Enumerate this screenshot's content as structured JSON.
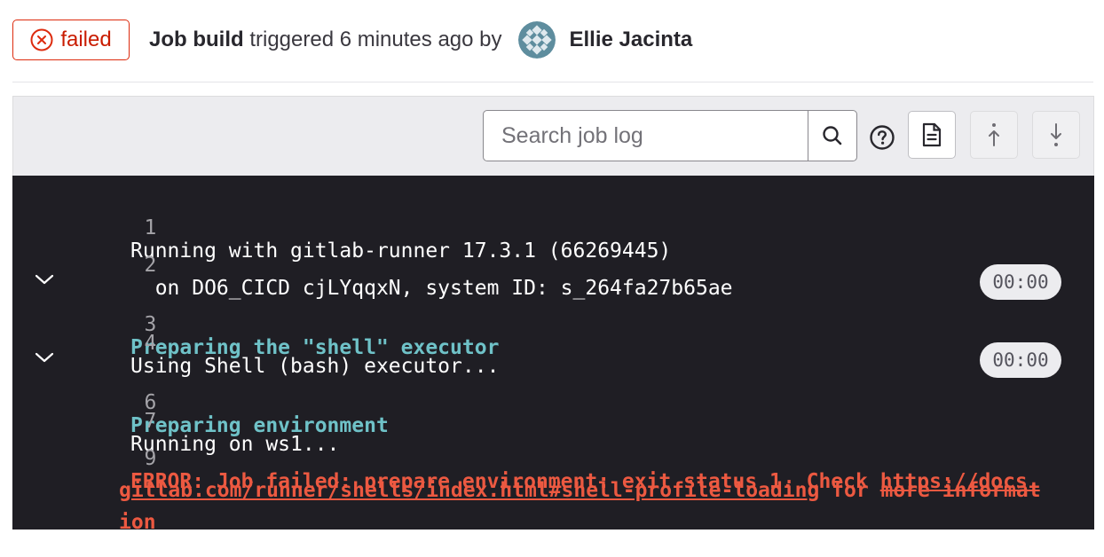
{
  "header": {
    "status": "failed",
    "job_label": "Job build",
    "trigger_text": "triggered 6 minutes ago by",
    "user_name": "Ellie Jacinta"
  },
  "toolbar": {
    "search_placeholder": "Search job log",
    "search_icon": "search-icon",
    "help_icon": "question-circle-icon",
    "raw_log_icon": "document-icon",
    "scroll_top_icon": "arrow-up-icon",
    "scroll_bottom_icon": "arrow-down-icon"
  },
  "log": {
    "lines": [
      {
        "number": "1",
        "text": "Running with gitlab-runner 17.3.1 (66269445)"
      },
      {
        "number": "2",
        "text": "  on DO6_CICD cjLYqqxN, system ID: s_264fa27b65ae"
      },
      {
        "number": "3",
        "text": "Preparing the \"shell\" executor",
        "section": true,
        "duration": "00:00"
      },
      {
        "number": "4",
        "text": "Using Shell (bash) executor..."
      },
      {
        "number": "6",
        "text": "Preparing environment",
        "section": true,
        "duration": "00:00"
      },
      {
        "number": "7",
        "text": "Running on ws1..."
      },
      {
        "number": "9",
        "error_prefix": "ERROR: Job failed: prepare environment: exit status 1. Check ",
        "link_part1": "https://docs.",
        "link_part2": "gitlab.com/runner/shells/index.html#shell-profile-loading",
        "error_suffix_1": " for more informat",
        "error_suffix_2": "ion"
      }
    ]
  },
  "colors": {
    "failed": "#dd2b0e",
    "log_background": "#1f1e24",
    "section_text": "#6fc2c8",
    "error_text": "#ec5941"
  }
}
